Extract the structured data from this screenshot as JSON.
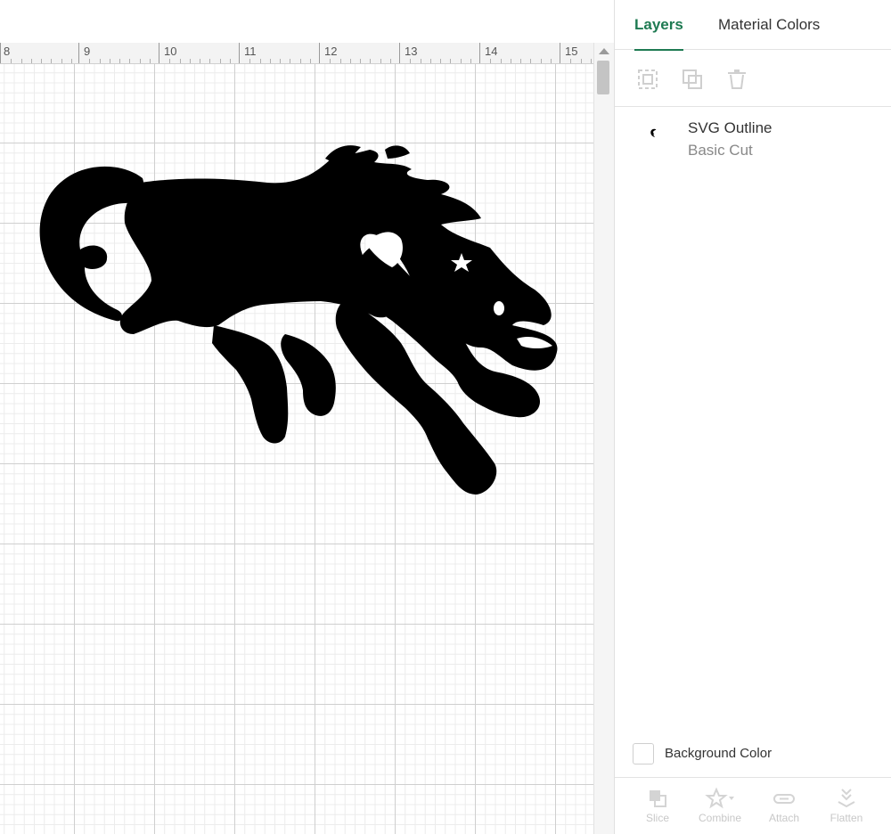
{
  "ruler": {
    "labels": [
      "8",
      "9",
      "10",
      "11",
      "12",
      "13",
      "14",
      "15"
    ]
  },
  "panel": {
    "tabs": [
      {
        "label": "Layers",
        "active": true
      },
      {
        "label": "Material Colors",
        "active": false
      }
    ],
    "tools": [
      "group-icon",
      "duplicate-icon",
      "delete-icon"
    ],
    "layer": {
      "name": "SVG Outline",
      "operation": "Basic Cut",
      "thumbnail": "horse-silhouette"
    },
    "background_color_label": "Background Color",
    "bottom_actions": [
      {
        "label": "Slice",
        "icon": "slice-icon"
      },
      {
        "label": "Combine",
        "icon": "combine-icon"
      },
      {
        "label": "Attach",
        "icon": "attach-icon"
      },
      {
        "label": "Flatten",
        "icon": "flatten-icon"
      }
    ]
  },
  "colors": {
    "accent": "#1e7a52",
    "design_fill": "#000000",
    "grid_major": "#cfcfcf",
    "grid_minor": "#ececec",
    "disabled_text": "#c8c8c8"
  }
}
